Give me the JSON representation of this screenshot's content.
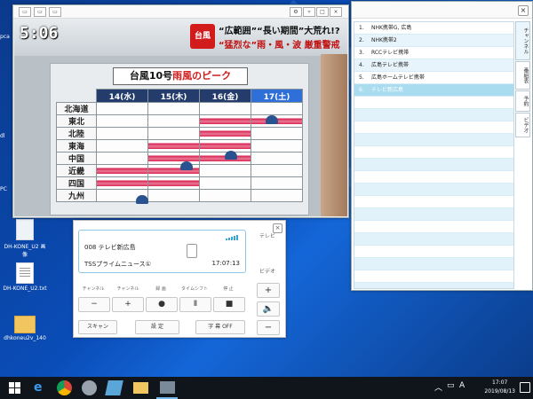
{
  "desktop": {
    "icons": [
      {
        "label": "DH-KONE_U2 画像",
        "type": "image"
      },
      {
        "label": "DH-KONE_U2.txt",
        "type": "txt"
      },
      {
        "label": "dhkoneu2v_140",
        "type": "folder"
      }
    ],
    "edge_labels": [
      "pca",
      "dl",
      "PC"
    ]
  },
  "tv_window": {
    "clock": "5:06",
    "news_badge": "台風",
    "headline_1": "“広範囲”“長い期間”大荒れ!?",
    "headline_2": "“猛烈な”雨・風・波 厳重警戒",
    "board_title_prefix": "台風10号",
    "board_title_red": "雨風のピーク",
    "days": [
      "14(水)",
      "15(木)",
      "16(金)",
      "17(土)"
    ],
    "regions": [
      "北海道",
      "東北",
      "北陸",
      "東海",
      "中国",
      "近畿",
      "四国",
      "九州"
    ]
  },
  "channel_window": {
    "channels": [
      {
        "num": "1.",
        "name": "NHK携帯G, 広島"
      },
      {
        "num": "2.",
        "name": "NHK携帯2"
      },
      {
        "num": "3.",
        "name": "RCCテレビ携帯"
      },
      {
        "num": "4.",
        "name": "広島テレビ携帯"
      },
      {
        "num": "5.",
        "name": "広島ホームテレビ携帯"
      },
      {
        "num": "6.",
        "name": "テレビ新広島"
      }
    ],
    "selected_index": 5,
    "side_tabs": [
      "チャンネル",
      "番組表",
      "予約",
      "ビデオ"
    ],
    "selected_color": "#a9dcef"
  },
  "remote_window": {
    "channel_line": "008 テレビ新広島",
    "program": "TSSプライムニュース①",
    "time": "17:07:13",
    "tv_label": "テレビ",
    "video_label": "ビデオ",
    "controls": [
      {
        "label": "チャンネル",
        "symbol": "−"
      },
      {
        "label": "チャンネル",
        "symbol": "+"
      },
      {
        "label": "録 画",
        "symbol": "●"
      },
      {
        "label": "タイムシフト",
        "symbol": "Ⅱ"
      },
      {
        "label": "停 止",
        "symbol": "■"
      }
    ],
    "buttons": {
      "scan": "スキャン",
      "settings": "設 定",
      "subtitles": "字 幕 OFF"
    },
    "volume": {
      "up": "+",
      "down": "−"
    }
  },
  "taskbar": {
    "time": "17:07",
    "date": "2019/08/13",
    "ime": "A",
    "accent": "#76b9ed"
  }
}
